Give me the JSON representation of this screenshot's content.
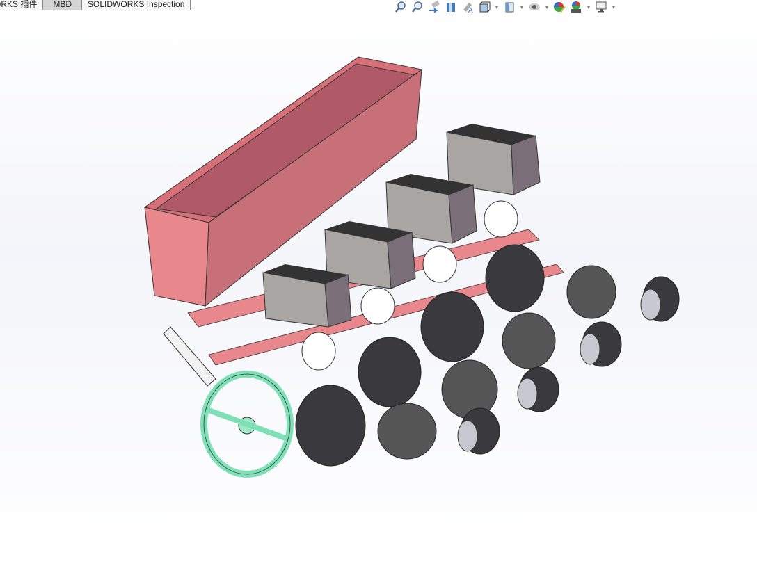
{
  "tabs": [
    {
      "label": "ORKS 插件"
    },
    {
      "label": "MBD",
      "active": true
    },
    {
      "label": "SOLIDWORKS Inspection"
    }
  ],
  "heads_up_toolbar": [
    {
      "icon": "zoom-to-fit-icon"
    },
    {
      "icon": "zoom-to-area-icon"
    },
    {
      "icon": "previous-view-icon"
    },
    {
      "icon": "section-view-icon"
    },
    {
      "icon": "dynamic-annotation-views-icon"
    },
    {
      "icon": "view-orientation-icon",
      "dropdown": true
    },
    {
      "icon": "display-style-icon",
      "dropdown": true
    },
    {
      "icon": "hide-show-items-icon",
      "dropdown": true
    },
    {
      "icon": "edit-appearance-icon"
    },
    {
      "icon": "apply-scene-icon",
      "dropdown": true
    },
    {
      "icon": "view-settings-icon",
      "dropdown": true
    }
  ],
  "colors": {
    "hopper": "#b05a68",
    "frame": "#e8888c",
    "seed_box": "#a8a5a2",
    "wheel": "#3a3a3e",
    "drive_wheel": "#7fe0b8",
    "press_wheel": "#c8c8d0"
  }
}
